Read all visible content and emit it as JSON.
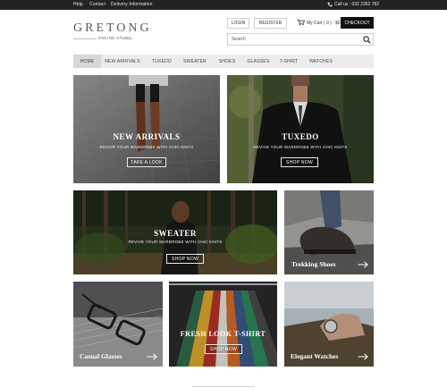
{
  "topbar": {
    "links": [
      "Help",
      "Contact",
      "Delivery Information"
    ],
    "phone_icon": "phone-icon",
    "phone": "Call us : 032 2352 782"
  },
  "logo": {
    "title": "GRETONG",
    "subtitle": "ONLINE STORE"
  },
  "account": {
    "login": "LOGIN",
    "register": "REGISTER",
    "cart_icon": "cart-icon",
    "cart": "My Cart ( 0 ) : $0",
    "checkout": "CHECKOUT"
  },
  "search": {
    "placeholder": "Search",
    "icon": "search-icon"
  },
  "nav": {
    "items": [
      "HOME",
      "NEW ARRIVALS",
      "TUXEDO",
      "SWEATER",
      "SHOES",
      "GLASSES",
      "T-SHIRT",
      "WATCHES"
    ],
    "active": "HOME"
  },
  "tiles": {
    "new_arrivals": {
      "title": "NEW ARRIVALS",
      "subtitle": "REVIVE YOUR WARDROBE WITH CHIC KNITS",
      "button": "TAKE A LOOK"
    },
    "tuxedo": {
      "title": "TUXEDO",
      "subtitle": "REVIVE YOUR WARDROBE WITH CHIC KNITS",
      "button": "SHOP NOW"
    },
    "sweater": {
      "title": "SWEATER",
      "subtitle": "REVIVE YOUR WARDROBE WITH CHIC KNITS",
      "button": "SHOP NOW"
    },
    "trekking": {
      "label": "Trekking Shoes",
      "icon": "arrow-right-icon"
    },
    "glasses": {
      "label": "Casual Glasses",
      "icon": "arrow-right-icon"
    },
    "tshirt": {
      "title": "FRESH LOOK T-SHIRT",
      "button": "SHOP NOW"
    },
    "watches": {
      "label": "Elegant Watches",
      "icon": "arrow-right-icon"
    }
  },
  "colors": {
    "topbar_bg": "#232323",
    "checkout_bg": "#111111",
    "nav_bg": "#ececec",
    "nav_active_bg": "#d7d7d7"
  }
}
